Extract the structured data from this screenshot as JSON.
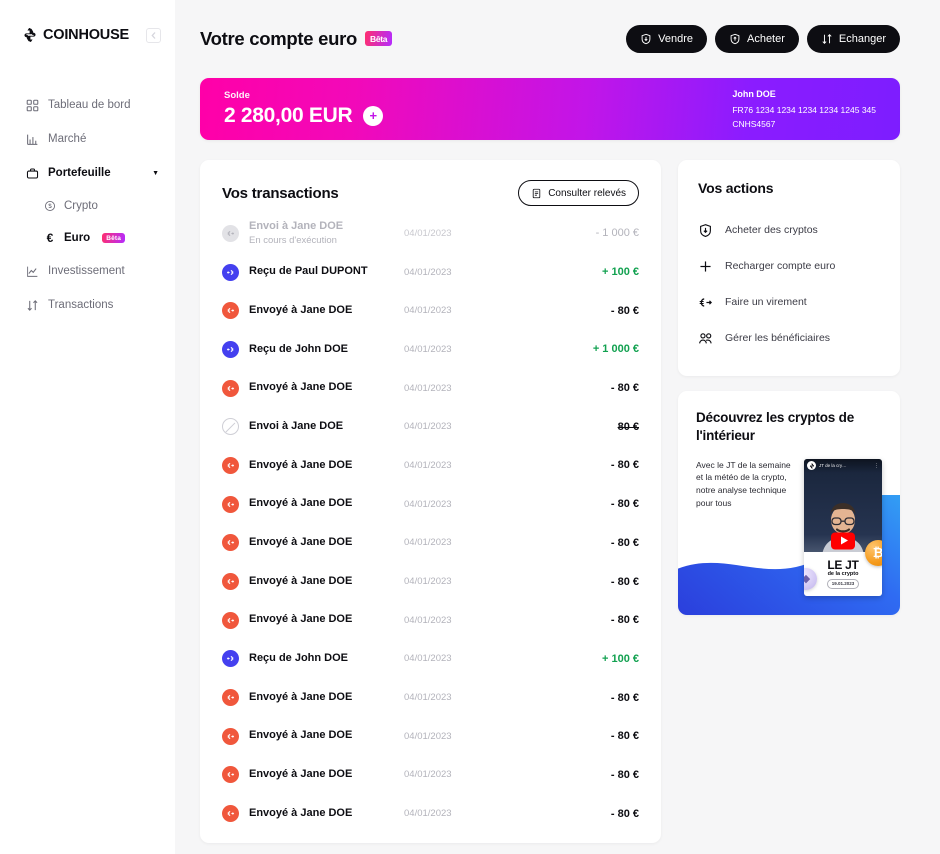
{
  "brand": {
    "name": "COINHOUSE",
    "logo_icon": "coinhouse-logo-icon",
    "collapse_icon": "sidebar-collapse-icon",
    "gradient_start": "#ff2f6e",
    "gradient_end": "#b42bff"
  },
  "sidebar": {
    "items": [
      {
        "label": "Tableau de bord",
        "icon": "dashboard-grid-icon"
      },
      {
        "label": "Marché",
        "icon": "bar-chart-icon"
      },
      {
        "label": "Portefeuille",
        "icon": "briefcase-icon",
        "caret": "▼"
      },
      {
        "label": "Investissement",
        "icon": "line-chart-icon"
      },
      {
        "label": "Transactions",
        "icon": "arrows-up-down-icon"
      }
    ],
    "sub_items": [
      {
        "label": "Crypto",
        "icon": "coin-s-icon"
      },
      {
        "label": "Euro",
        "icon": "euro-sign-icon",
        "badge": "Bêta"
      }
    ]
  },
  "header": {
    "title": "Votre compte euro",
    "badge": "Bêta",
    "buttons": [
      {
        "label": "Vendre",
        "icon": "shield-arrow-down-icon"
      },
      {
        "label": "Acheter",
        "icon": "shield-arrow-up-icon"
      },
      {
        "label": "Echanger",
        "icon": "arrows-up-down-icon"
      }
    ]
  },
  "balance": {
    "label": "Solde",
    "amount": "2 280,00 EUR",
    "add_icon": "plus-icon",
    "owner": "John DOE",
    "iban": "FR76 1234 1234 1234 1234 1245 345",
    "bic": "CNHS4567"
  },
  "transactions": {
    "title": "Vos transactions",
    "statement_button": {
      "label": "Consulter relevés",
      "icon": "document-icon"
    },
    "rows": [
      {
        "label": "Envoi à Jane DOE",
        "sub": "En cours d'exécution",
        "date": "04/01/2023",
        "amount": "- 1 000 €",
        "kind": "pending",
        "icon": "euro-send-icon"
      },
      {
        "label": "Reçu de Paul DUPONT",
        "sub": "",
        "date": "04/01/2023",
        "amount": "+ 100 €",
        "kind": "recv",
        "icon": "euro-receive-icon"
      },
      {
        "label": "Envoyé à Jane DOE",
        "sub": "",
        "date": "04/01/2023",
        "amount": "- 80 €",
        "kind": "send",
        "icon": "euro-send-icon"
      },
      {
        "label": "Reçu de John DOE",
        "sub": "",
        "date": "04/01/2023",
        "amount": "+ 1 000 €",
        "kind": "recv",
        "icon": "euro-receive-icon"
      },
      {
        "label": "Envoyé à Jane DOE",
        "sub": "",
        "date": "04/01/2023",
        "amount": "- 80 €",
        "kind": "send",
        "icon": "euro-send-icon"
      },
      {
        "label": "Envoi à Jane DOE",
        "sub": "",
        "date": "04/01/2023",
        "amount": "80 €",
        "kind": "cancelled",
        "icon": "cancelled-circle-icon"
      },
      {
        "label": "Envoyé à Jane DOE",
        "sub": "",
        "date": "04/01/2023",
        "amount": "- 80 €",
        "kind": "send",
        "icon": "euro-send-icon"
      },
      {
        "label": "Envoyé à Jane DOE",
        "sub": "",
        "date": "04/01/2023",
        "amount": "- 80 €",
        "kind": "send",
        "icon": "euro-send-icon"
      },
      {
        "label": "Envoyé à Jane DOE",
        "sub": "",
        "date": "04/01/2023",
        "amount": "- 80 €",
        "kind": "send",
        "icon": "euro-send-icon"
      },
      {
        "label": "Envoyé à Jane DOE",
        "sub": "",
        "date": "04/01/2023",
        "amount": "- 80 €",
        "kind": "send",
        "icon": "euro-send-icon"
      },
      {
        "label": "Envoyé à Jane DOE",
        "sub": "",
        "date": "04/01/2023",
        "amount": "- 80 €",
        "kind": "send",
        "icon": "euro-send-icon"
      },
      {
        "label": "Reçu de John DOE",
        "sub": "",
        "date": "04/01/2023",
        "amount": "+ 100 €",
        "kind": "recv",
        "icon": "euro-receive-icon"
      },
      {
        "label": "Envoyé à Jane DOE",
        "sub": "",
        "date": "04/01/2023",
        "amount": "- 80 €",
        "kind": "send",
        "icon": "euro-send-icon"
      },
      {
        "label": "Envoyé à Jane DOE",
        "sub": "",
        "date": "04/01/2023",
        "amount": "- 80 €",
        "kind": "send",
        "icon": "euro-send-icon"
      },
      {
        "label": "Envoyé à Jane DOE",
        "sub": "",
        "date": "04/01/2023",
        "amount": "- 80 €",
        "kind": "send",
        "icon": "euro-send-icon"
      },
      {
        "label": "Envoyé à Jane DOE",
        "sub": "",
        "date": "04/01/2023",
        "amount": "- 80 €",
        "kind": "send",
        "icon": "euro-send-icon"
      }
    ]
  },
  "actions": {
    "title": "Vos actions",
    "items": [
      {
        "label": "Acheter des cryptos",
        "icon": "shield-arrow-down-icon"
      },
      {
        "label": "Recharger compte euro",
        "icon": "plus-icon"
      },
      {
        "label": "Faire un virement",
        "icon": "euro-arrow-right-icon"
      },
      {
        "label": "Gérer les bénéficiaires",
        "icon": "users-icon"
      }
    ]
  },
  "promo": {
    "title": "Découvrez les cryptos de l'intérieur",
    "text": "Avec le JT de la semaine et la météo de la crypto, notre analyse technique pour tous",
    "video": {
      "channel": "JT de la cry…",
      "play_icon": "youtube-play-icon",
      "overlay_title": "LE JT",
      "overlay_sub": "de la crypto",
      "overlay_date": "19.01.2023"
    }
  },
  "colors": {
    "send": "#f0573c",
    "receive": "#4440ef",
    "positive": "#12a150",
    "dark": "#0d0d12"
  }
}
